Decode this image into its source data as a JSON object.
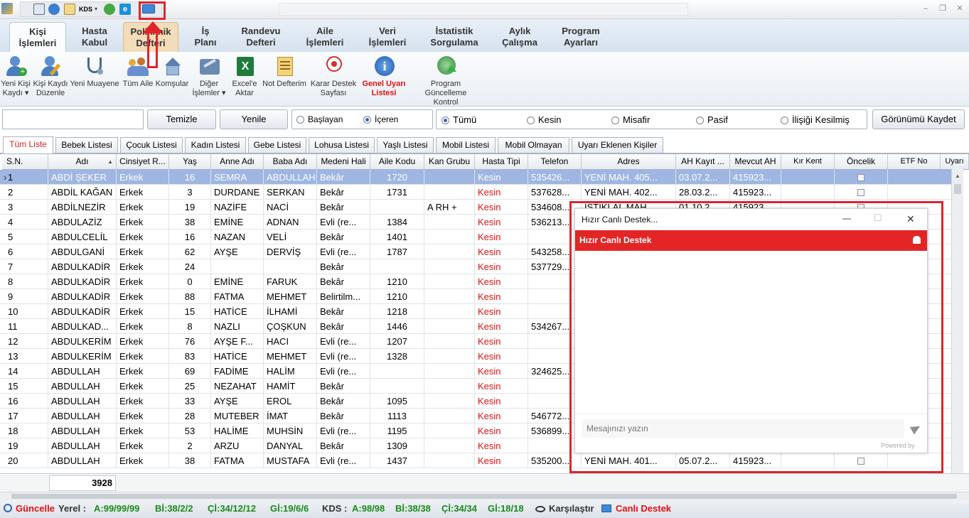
{
  "quickaccess": {
    "kds_label": "KDS",
    "dropdown_glyph": "▾"
  },
  "window": {
    "minimize": "–",
    "restore": "❐",
    "close": "✕"
  },
  "ribbon_tabs": [
    {
      "line1": "Kişi",
      "line2": "İşlemleri"
    },
    {
      "line1": "Hasta",
      "line2": "Kabul"
    },
    {
      "line1": "Poliklinik",
      "line2": "Defteri"
    },
    {
      "line1": "İş",
      "line2": "Planı"
    },
    {
      "line1": "Randevu",
      "line2": "Defteri"
    },
    {
      "line1": "Aile",
      "line2": "İşlemleri"
    },
    {
      "line1": "Veri",
      "line2": "İşlemleri"
    },
    {
      "line1": "İstatistik",
      "line2": "Sorgulama"
    },
    {
      "line1": "Aylık",
      "line2": "Çalışma"
    },
    {
      "line1": "Program",
      "line2": "Ayarları"
    }
  ],
  "tools": [
    {
      "line1": "Yeni Kişi",
      "line2": "Kaydı ▾",
      "icon": "user-add-icon"
    },
    {
      "line1": "Kişi Kaydı",
      "line2": "Düzenle",
      "icon": "user-edit-icon"
    },
    {
      "line1": "Yeni Muayene",
      "line2": "",
      "icon": "stethoscope-icon"
    },
    {
      "line1": "Tüm Aile",
      "line2": "",
      "icon": "family-icon"
    },
    {
      "line1": "Komşular",
      "line2": "",
      "icon": "house-icon"
    },
    {
      "line1": "Diğer",
      "line2": "İşlemler ▾",
      "icon": "tools-icon"
    },
    {
      "line1": "Excel'e",
      "line2": "Aktar",
      "icon": "excel-icon"
    },
    {
      "line1": "Not Defterim",
      "line2": "",
      "icon": "notepad-icon"
    },
    {
      "line1": "Karar Destek",
      "line2": "Sayfası",
      "icon": "health-logo-icon"
    },
    {
      "line1": "Genel Uyarı",
      "line2": "Listesi",
      "icon": "info-icon"
    },
    {
      "line1": "Program Güncelleme",
      "line2": "Kontrol",
      "icon": "globe-update-icon"
    }
  ],
  "filter": {
    "search_value": "",
    "clear_label": "Temizle",
    "refresh_label": "Yenile",
    "match_options": [
      {
        "label": "Başlayan",
        "selected": false
      },
      {
        "label": "İçeren",
        "selected": true
      }
    ],
    "status_options": [
      {
        "label": "Tümü",
        "selected": true
      },
      {
        "label": "Kesin",
        "selected": false
      },
      {
        "label": "Misafir",
        "selected": false
      },
      {
        "label": "Pasif",
        "selected": false
      },
      {
        "label": "İlişiği Kesilmiş",
        "selected": false
      }
    ],
    "save_view_label": "Görünümü Kaydet"
  },
  "list_tabs": [
    "Tüm Liste",
    "Bebek Listesi",
    "Çocuk Listesi",
    "Kadın Listesi",
    "Gebe Listesi",
    "Lohusa Listesi",
    "Yaşlı Listesi",
    "Mobil Listesi",
    "Mobil Olmayan",
    "Uyarı Eklenen Kişiler"
  ],
  "columns": [
    "S.N.",
    "Adı",
    "Cinsiyet R...",
    "Yaş",
    "Anne Adı",
    "Baba Adı",
    "Medeni Hali",
    "Aile Kodu",
    "Kan Grubu",
    "Hasta Tipi",
    "Telefon",
    "Adres",
    "AH Kayıt ...",
    "Mevcut AH",
    "Kır Kent",
    "Öncelik",
    "ETF No",
    "Uyarı"
  ],
  "sort_glyph": "▲",
  "row_indicator": "›",
  "rows": [
    [
      "1",
      "ABDİ ŞEKER",
      "Erkek",
      "16",
      "SEMRA",
      "ABDULLAH",
      "Bekâr",
      "1720",
      "",
      "Kesin",
      "535426...",
      "YENİ MAH. 405...",
      "03.07.2...",
      "415923...",
      "",
      ""
    ],
    [
      "2",
      "ABDİL KAĞAN",
      "Erkek",
      "3",
      "DURDANE",
      "SERKAN",
      "Bekâr",
      "1731",
      "",
      "Kesin",
      "537628...",
      "YENİ MAH. 402...",
      "28.03.2...",
      "415923...",
      "",
      ""
    ],
    [
      "3",
      "ABDİLNEZİR",
      "Erkek",
      "19",
      "NAZİFE",
      "NACİ",
      "Bekâr",
      "",
      "A RH +",
      "Kesin",
      "534608...",
      "İSTİKLAL MAH...",
      "01.10.2...",
      "415923...",
      "",
      ""
    ],
    [
      "4",
      "ABDULAZİZ",
      "Erkek",
      "38",
      "EMİNE",
      "ADNAN",
      "Evli (re...",
      "1384",
      "",
      "Kesin",
      "536213...",
      "",
      "",
      "",
      "",
      ""
    ],
    [
      "5",
      "ABDULCELİL",
      "Erkek",
      "16",
      "NAZAN",
      "VELİ",
      "Bekâr",
      "1401",
      "",
      "Kesin",
      "",
      "",
      "",
      "",
      "",
      ""
    ],
    [
      "6",
      "ABDULGANİ",
      "Erkek",
      "62",
      "AYŞE",
      "DERVİŞ",
      "Evli (re...",
      "1787",
      "",
      "Kesin",
      "543258...",
      "",
      "",
      "",
      "",
      ""
    ],
    [
      "7",
      "ABDULKADİR",
      "Erkek",
      "24",
      "",
      "",
      "Bekâr",
      "",
      "",
      "Kesin",
      "537729...",
      "",
      "",
      "",
      "",
      ""
    ],
    [
      "8",
      "ABDULKADİR",
      "Erkek",
      "0",
      "EMİNE",
      "FARUK",
      "Bekâr",
      "1210",
      "",
      "Kesin",
      "",
      "",
      "",
      "",
      "",
      ""
    ],
    [
      "9",
      "ABDULKADİR",
      "Erkek",
      "88",
      "FATMA",
      "MEHMET",
      "Belirtilm...",
      "1210",
      "",
      "Kesin",
      "",
      "",
      "",
      "",
      "",
      ""
    ],
    [
      "10",
      "ABDULKADİR",
      "Erkek",
      "15",
      "HATİCE",
      "İLHAMİ",
      "Bekâr",
      "1218",
      "",
      "Kesin",
      "",
      "",
      "",
      "",
      "",
      ""
    ],
    [
      "11",
      "ABDULKAD...",
      "Erkek",
      "8",
      "NAZLI",
      "ÇOŞKUN",
      "Bekâr",
      "1446",
      "",
      "Kesin",
      "534267...",
      "",
      "",
      "",
      "",
      ""
    ],
    [
      "12",
      "ABDULKERİM",
      "Erkek",
      "76",
      "AYŞE F...",
      "HACI",
      "Evli (re...",
      "1207",
      "",
      "Kesin",
      "",
      "",
      "",
      "",
      "",
      ""
    ],
    [
      "13",
      "ABDULKERİM",
      "Erkek",
      "83",
      "HATİCE",
      "MEHMET",
      "Evli (re...",
      "1328",
      "",
      "Kesin",
      "",
      "",
      "",
      "",
      "",
      ""
    ],
    [
      "14",
      "ABDULLAH",
      "Erkek",
      "69",
      "FADİME",
      "HALİM",
      "Evli (re...",
      "",
      "",
      "Kesin",
      "324625...",
      "",
      "",
      "",
      "",
      ""
    ],
    [
      "15",
      "ABDULLAH",
      "Erkek",
      "25",
      "NEZAHAT",
      "HAMİT",
      "Bekâr",
      "",
      "",
      "Kesin",
      "",
      "",
      "",
      "",
      "",
      ""
    ],
    [
      "16",
      "ABDULLAH",
      "Erkek",
      "33",
      "AYŞE",
      "EROL",
      "Bekâr",
      "1095",
      "",
      "Kesin",
      "",
      "",
      "",
      "",
      "",
      ""
    ],
    [
      "17",
      "ABDULLAH",
      "Erkek",
      "28",
      "MUTEBER",
      "İMAT",
      "Bekâr",
      "1113",
      "",
      "Kesin",
      "546772...",
      "",
      "",
      "",
      "",
      ""
    ],
    [
      "18",
      "ABDULLAH",
      "Erkek",
      "53",
      "HALİME",
      "MUHSİN",
      "Evli (re...",
      "1195",
      "",
      "Kesin",
      "536899...",
      "",
      "",
      "",
      "",
      ""
    ],
    [
      "19",
      "ABDULLAH",
      "Erkek",
      "2",
      "ARZU",
      "DANYAL",
      "Bekâr",
      "1309",
      "",
      "Kesin",
      "",
      "",
      "",
      "",
      "",
      ""
    ],
    [
      "20",
      "ABDULLAH",
      "Erkek",
      "38",
      "FATMA",
      "MUSTAFA",
      "Evli (re...",
      "1437",
      "",
      "Kesin",
      "535200...",
      "YENİ MAH. 401...",
      "05.07.2...",
      "415923...",
      "",
      ""
    ]
  ],
  "footer": {
    "total": "3928"
  },
  "status": {
    "update": "Güncelle",
    "local_label": "Yerel :",
    "local_a": "A:99/99/99",
    "local_b": "Bİ:38/2/2",
    "local_c": "Çİ:34/12/12",
    "local_g": "Gİ:19/6/6",
    "kds_label": "KDS :",
    "kds_a": "A:98/98",
    "kds_b": "Bİ:38/38",
    "kds_c": "Çİ:34/34",
    "kds_g": "Gİ:18/18",
    "compare": "Karşılaştır",
    "live_support": "Canlı Destek"
  },
  "chat": {
    "window_title": "Hızır Canlı Destek...",
    "header": "Hızır Canlı Destek",
    "input_placeholder": "Mesajınızı yazın",
    "powered_by": "Powered by",
    "minimize": "—",
    "maximize": "☐",
    "close": "✕"
  },
  "colors": {
    "accent_red": "#e32526",
    "selection": "#9fb6e2",
    "status_green": "#1a8a1a",
    "kesin_red": "#e01010"
  }
}
